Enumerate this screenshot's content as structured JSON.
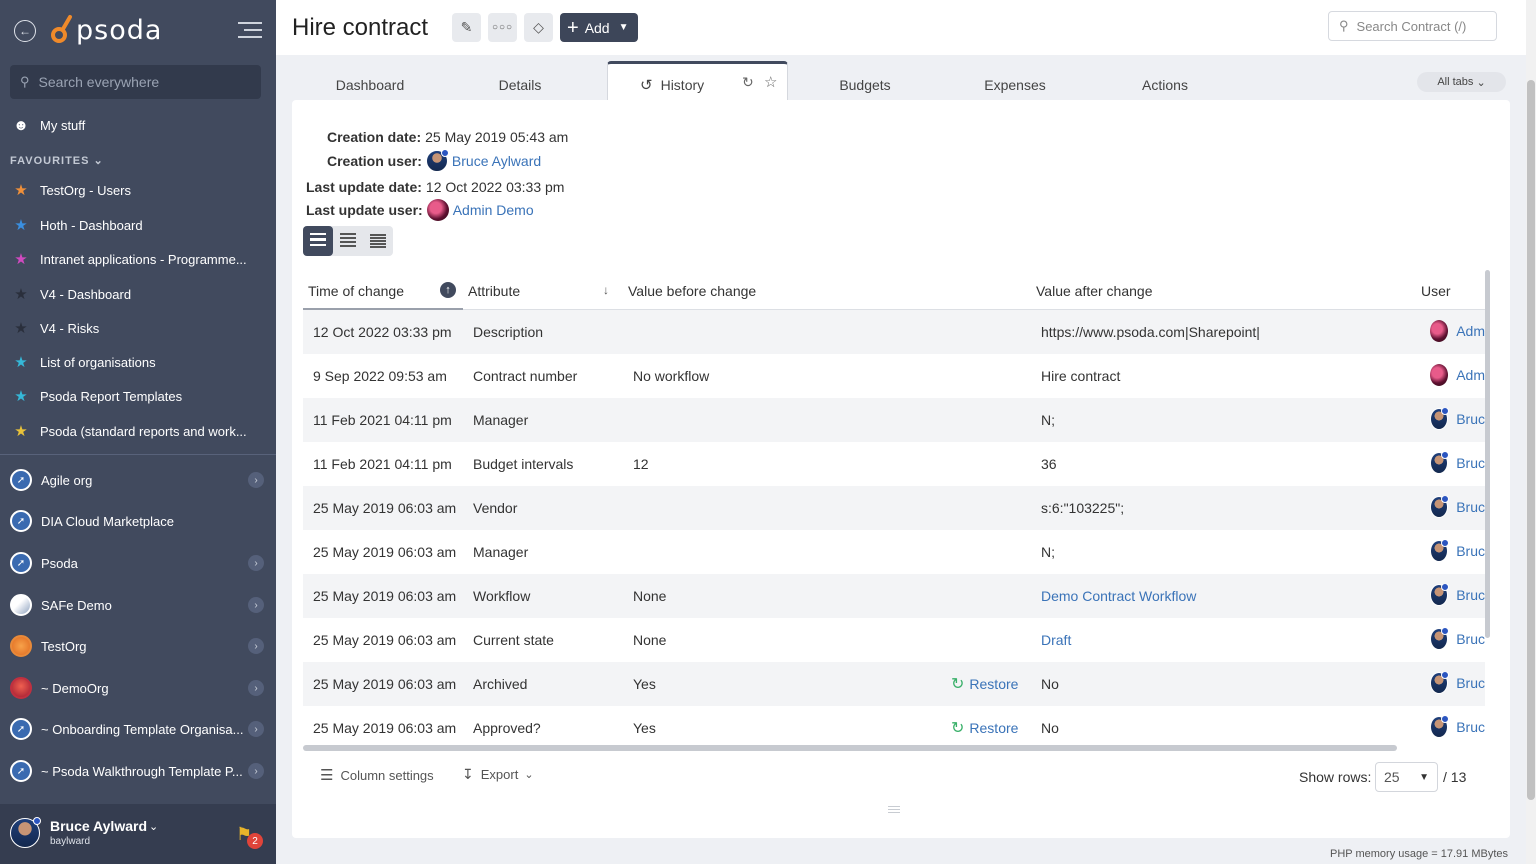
{
  "app": {
    "logo_text": "psoda"
  },
  "sidebar": {
    "search_placeholder": "Search everywhere",
    "my_stuff": "My stuff",
    "favourites_label": "FAVOURITES",
    "favourites": [
      {
        "label": "TestOrg - Users",
        "color": "#f0903a"
      },
      {
        "label": "Hoth - Dashboard",
        "color": "#3a8fe0"
      },
      {
        "label": "Intranet applications - Programme...",
        "color": "#d04ac0"
      },
      {
        "label": "V4 - Dashboard",
        "color": "#2a2f3c"
      },
      {
        "label": "V4 - Risks",
        "color": "#2a2f3c"
      },
      {
        "label": "List of organisations",
        "color": "#35b8d8"
      },
      {
        "label": "Psoda Report Templates",
        "color": "#35b8d8"
      },
      {
        "label": "Psoda (standard reports and work...",
        "color": "#e8c23a"
      }
    ],
    "orgs": [
      {
        "label": "Agile org",
        "chevron": true
      },
      {
        "label": "DIA Cloud Marketplace",
        "chevron": false
      },
      {
        "label": "Psoda",
        "chevron": true
      },
      {
        "label": "SAFe Demo",
        "chevron": true
      },
      {
        "label": "TestOrg",
        "chevron": true
      },
      {
        "label": "~ DemoOrg",
        "chevron": true
      },
      {
        "label": "~ Onboarding Template Organisa...",
        "chevron": true
      },
      {
        "label": "~ Psoda Walkthrough Template P...",
        "chevron": true
      }
    ],
    "user": {
      "name": "Bruce Aylward",
      "username": "baylward",
      "notifications": "2"
    }
  },
  "header": {
    "title": "Hire contract",
    "add_label": "Add",
    "search_placeholder": "Search Contract (/)"
  },
  "tabs": [
    {
      "label": "Dashboard"
    },
    {
      "label": "Details"
    },
    {
      "label": "History"
    },
    {
      "label": "Budgets"
    },
    {
      "label": "Expenses"
    },
    {
      "label": "Actions"
    }
  ],
  "all_tabs_label": "All tabs",
  "meta": {
    "creation_date_label": "Creation date:",
    "creation_date": "25 May 2019 05:43 am",
    "creation_user_label": "Creation user:",
    "creation_user": "Bruce Aylward",
    "last_update_date_label": "Last update date:",
    "last_update_date": "12 Oct 2022 03:33 pm",
    "last_update_user_label": "Last update user:",
    "last_update_user": "Admin Demo"
  },
  "table": {
    "columns": [
      "Time of change",
      "Attribute",
      "Value before change",
      "Value after change",
      "User"
    ],
    "rows": [
      {
        "time": "12 Oct 2022 03:33 pm",
        "attribute": "Description",
        "before": "",
        "after": "https://www.psoda.com|Sharepoint|",
        "after_link": false,
        "restore": "",
        "user": "Adm",
        "user_type": "admin"
      },
      {
        "time": "9 Sep 2022 09:53 am",
        "attribute": "Contract number",
        "before": "No workflow",
        "after": "Hire contract",
        "after_link": false,
        "restore": "",
        "user": "Adm",
        "user_type": "admin"
      },
      {
        "time": "11 Feb 2021 04:11 pm",
        "attribute": "Manager",
        "before": "",
        "after": "N;",
        "after_link": false,
        "restore": "",
        "user": "Bruc",
        "user_type": "bruce"
      },
      {
        "time": "11 Feb 2021 04:11 pm",
        "attribute": "Budget intervals",
        "before": "12",
        "after": "36",
        "after_link": false,
        "restore": "",
        "user": "Bruc",
        "user_type": "bruce"
      },
      {
        "time": "25 May 2019 06:03 am",
        "attribute": "Vendor",
        "before": "",
        "after": "s:6:\"103225\";",
        "after_link": false,
        "restore": "",
        "user": "Bruc",
        "user_type": "bruce"
      },
      {
        "time": "25 May 2019 06:03 am",
        "attribute": "Manager",
        "before": "",
        "after": "N;",
        "after_link": false,
        "restore": "",
        "user": "Bruc",
        "user_type": "bruce"
      },
      {
        "time": "25 May 2019 06:03 am",
        "attribute": "Workflow",
        "before": "None",
        "after": "Demo Contract Workflow",
        "after_link": true,
        "restore": "",
        "user": "Bruc",
        "user_type": "bruce"
      },
      {
        "time": "25 May 2019 06:03 am",
        "attribute": "Current state",
        "before": "None",
        "after": "Draft",
        "after_link": true,
        "restore": "",
        "user": "Bruc",
        "user_type": "bruce"
      },
      {
        "time": "25 May 2019 06:03 am",
        "attribute": "Archived",
        "before": "Yes",
        "after": "No",
        "after_link": false,
        "restore": "Restore",
        "user": "Bruc",
        "user_type": "bruce"
      },
      {
        "time": "25 May 2019 06:03 am",
        "attribute": "Approved?",
        "before": "Yes",
        "after": "No",
        "after_link": false,
        "restore": "Restore",
        "user": "Bruc",
        "user_type": "bruce"
      }
    ]
  },
  "footer": {
    "column_settings": "Column settings",
    "export": "Export",
    "show_rows_label": "Show rows:",
    "rows_value": "25",
    "pages": "/ 13"
  },
  "memory_usage": "PHP memory usage = 17.91 MBytes"
}
